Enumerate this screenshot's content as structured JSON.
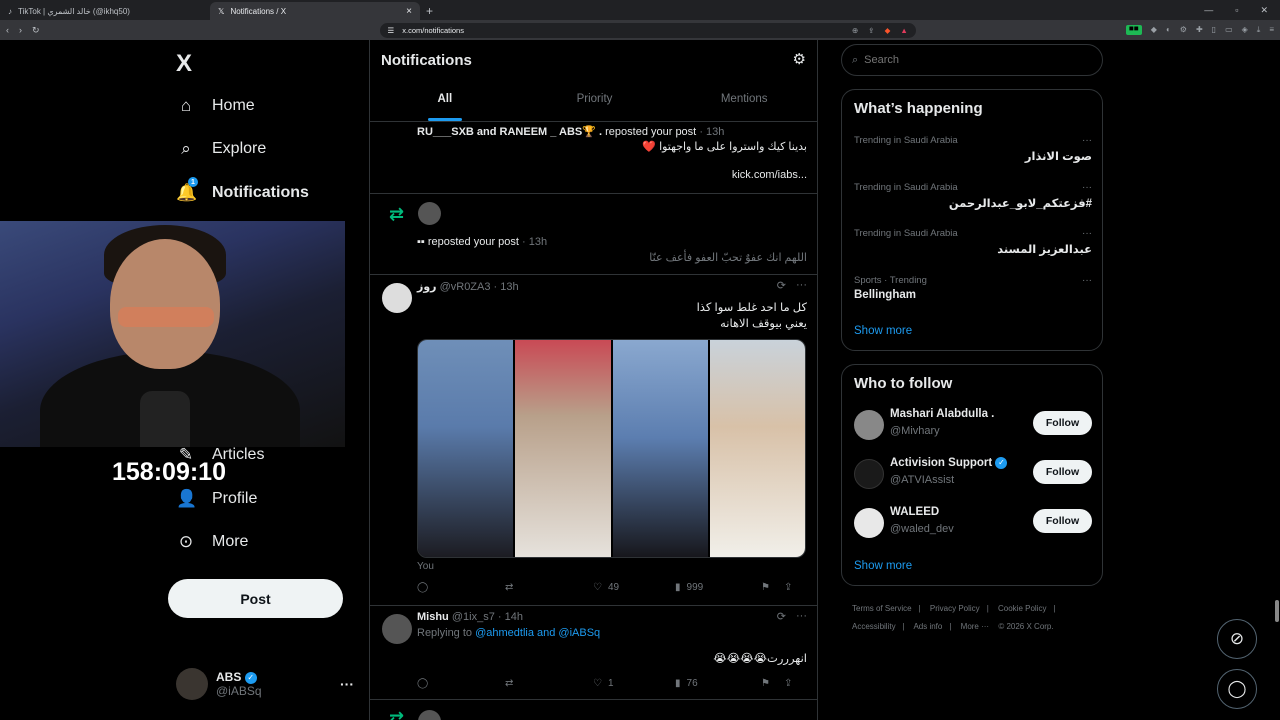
{
  "browser": {
    "tabs": [
      {
        "label": "TikTok | خالد الشمري (@ikhq50)"
      },
      {
        "label": "Notifications / X"
      }
    ],
    "url": "x.com/notifications"
  },
  "sidebar": {
    "logo": "X",
    "items": [
      {
        "label": "Home",
        "icon": "home-icon"
      },
      {
        "label": "Explore",
        "icon": "search-icon"
      },
      {
        "label": "Notifications",
        "icon": "bell-icon",
        "badge": "1"
      },
      {
        "label": "Articles",
        "icon": "article-icon"
      },
      {
        "label": "Profile",
        "icon": "person-icon"
      },
      {
        "label": "More",
        "icon": "more-circle-icon"
      }
    ],
    "post_label": "Post",
    "account": {
      "name": "ABS",
      "handle": "@iABSq"
    }
  },
  "overlay": {
    "timer": "158:09:10"
  },
  "main": {
    "title": "Notifications",
    "tabs": [
      {
        "label": "All"
      },
      {
        "label": "Priority"
      },
      {
        "label": "Mentions"
      }
    ],
    "notif1": {
      "users": "RU___SXB and RANEEM _ ABS🏆 .",
      "action": "reposted your post",
      "time": "· 13h",
      "text": "بدينا كيك واستروا على ما واجهتوا ❤️",
      "link": "kick.com/iabs..."
    },
    "notif2": {
      "action": "reposted your post",
      "time": "· 13h",
      "text": "اللهم انك عفوٌ تحبّ العفو فأعف عنّا"
    },
    "post1": {
      "name": "روز",
      "handle": "@vR0ZA3",
      "time": "· 13h",
      "line1": "كل ما احد غلط سوا كذا",
      "line2": "يعني بيوقف الاهانه",
      "you": "You",
      "likes": "49",
      "views": "999"
    },
    "post2": {
      "name": "Mishu",
      "handle": "@1ix_s7",
      "time": "· 14h",
      "replying_prefix": "Replying to",
      "replying_to": "@ahmedtlia and @iABSq",
      "text": "انهرررت😭😭😭😭",
      "likes": "1",
      "views": "76"
    }
  },
  "right": {
    "search_placeholder": "Search",
    "trending_title": "What’s happening",
    "trends": [
      {
        "category": "Trending in Saudi Arabia",
        "name": "صوت الانذار"
      },
      {
        "category": "Trending in Saudi Arabia",
        "name": "#فزعتكم_لابو_عبدالرحمن"
      },
      {
        "category": "Trending in Saudi Arabia",
        "name": "عبدالعزيز المسند"
      },
      {
        "category": "Sports · Trending",
        "name": "Bellingham"
      }
    ],
    "show_more": "Show more",
    "who_title": "Who to follow",
    "follow": [
      {
        "name": "Mashari Alabdulla .",
        "handle": "@Mivhary",
        "verified": false
      },
      {
        "name": "Activision Support",
        "handle": "@ATVIAssist",
        "verified": true
      },
      {
        "name": "WALEED",
        "handle": "@waled_dev",
        "verified": false
      }
    ],
    "follow_label": "Follow",
    "footer": [
      "Terms of Service",
      "|",
      "Privacy Policy",
      "|",
      "Cookie Policy",
      "|",
      "Accessibility",
      "|",
      "Ads info",
      "|",
      "More ···",
      "© 2026 X Corp."
    ]
  },
  "colors": {
    "accent": "#1d9bf0",
    "repost": "#00ba7c",
    "bg": "#000000",
    "border": "#2f3336"
  }
}
